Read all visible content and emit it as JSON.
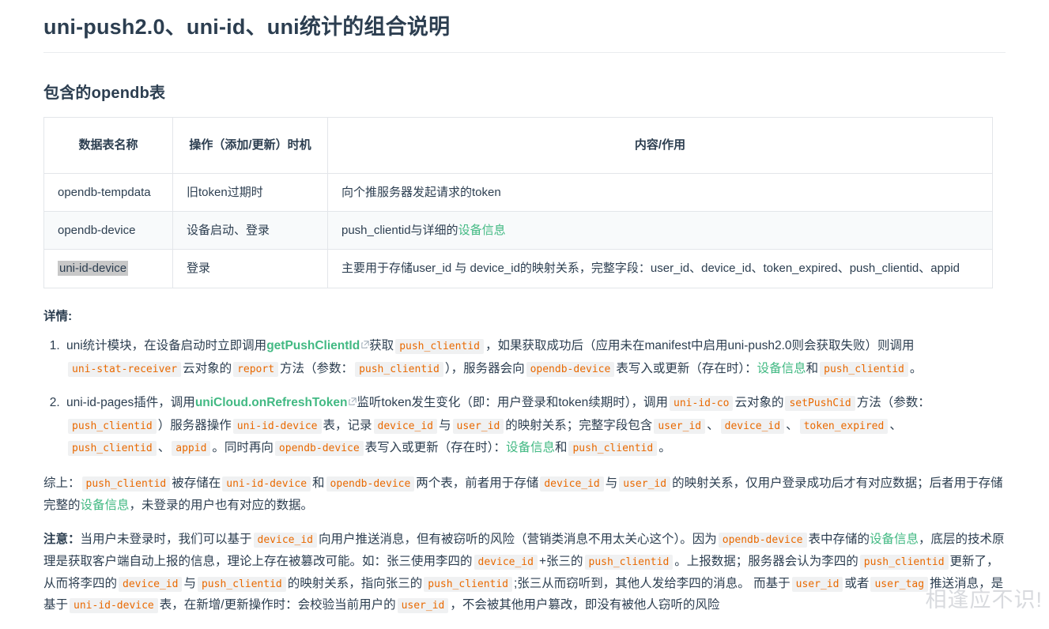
{
  "doc": {
    "title": "uni-push2.0、uni-id、uni统计的组合说明",
    "section_title": "包含的opendb表"
  },
  "colors": {
    "link_green": "#42b983",
    "code_orange": "#e96900",
    "code_bg": "#f0f1f2",
    "text": "#2c3e50",
    "border": "#e3e6ea",
    "row_stripe": "#f8fafb",
    "selection_gray": "#c8c8c8",
    "watermark": "#d8dade"
  },
  "table": {
    "headers": [
      "数据表名称",
      "操作（添加/更新）时机",
      "内容/作用"
    ],
    "rows": [
      {
        "name": "opendb-tempdata",
        "op": "旧token过期时",
        "content_pre": "向个推服务器发起请求的token",
        "link": "",
        "content_post": "",
        "striped": false,
        "selected": false
      },
      {
        "name": "opendb-device",
        "op": "设备启动、登录",
        "content_pre": "push_clientid与详细的",
        "link": "设备信息",
        "content_post": "",
        "striped": true,
        "selected": false
      },
      {
        "name": "uni-id-device",
        "op": "登录",
        "content_pre": "主要用于存储user_id 与 device_id的映射关系，完整字段：user_id、device_id、token_expired、push_clientid、appid",
        "link": "",
        "content_post": "",
        "striped": false,
        "selected": true
      }
    ]
  },
  "details": {
    "lead": "详情:",
    "item1": {
      "t1": "uni统计模块，在设备启动时立即调用",
      "link1": "getPushClientId",
      "t2": "获取",
      "c1": "push_clientid",
      "t3": "，如果获取成功后（应用未在manifest中启用uni-push2.0则会获取失败）则调用",
      "c2": "uni-stat-receiver",
      "t4": "云对象的",
      "c3": "report",
      "t5": "方法（参数：",
      "c4": "push_clientid",
      "t6": "），服务器会向",
      "c5": "opendb-device",
      "t7": "表写入或更新（存在时）：",
      "link2": "设备信息",
      "t8": "和",
      "c6": "push_clientid",
      "t9": "。"
    },
    "item2": {
      "t1": "uni-id-pages插件，调用",
      "link1": "uniCloud.onRefreshToken",
      "t2": "监听token发生变化（即：用户登录和token续期时），调用",
      "c1": "uni-id-co",
      "t3": "云对象的",
      "c2": "setPushCid",
      "t4": "方法（参数：",
      "c3": "push_clientid",
      "t5": "）服务器操作",
      "c4": "uni-id-device",
      "t6": "表，记录",
      "c5": "device_id",
      "t7": "与",
      "c6": "user_id",
      "t8": "的映射关系；完整字段包含",
      "c7": "user_id",
      "t9": "、",
      "c8": "device_id",
      "t10": "、",
      "c9": "token_expired",
      "t11": "、",
      "c10": "push_clientid",
      "t12": "、",
      "c11": "appid",
      "t13": "。同时再向",
      "c12": "opendb-device",
      "t14": "表写入或更新（存在时）：",
      "link2": "设备信息",
      "t15": "和",
      "c13": "push_clientid",
      "t16": "。"
    }
  },
  "summary": {
    "lead": "综上：",
    "c1": "push_clientid",
    "t1": "被存储在",
    "c2": "uni-id-device",
    "t2": "和",
    "c3": "opendb-device",
    "t3": "两个表，前者用于存储",
    "c4": "device_id",
    "t4": "与",
    "c5": "user_id",
    "t5": "的映射关系，仅用户登录成功后才有对应数据；后者用于存储完整的",
    "link1": "设备信息",
    "t6": "，未登录的用户也有对应的数据。"
  },
  "notice": {
    "lead": "注意：",
    "t1": "当用户未登录时，我们可以基于",
    "c1": "device_id",
    "t2": "向用户推送消息，但有被窃听的风险（营销类消息不用太关心这个）。因为",
    "c2": "opendb-device",
    "t3": "表中存储的",
    "link1": "设备信息",
    "t4": "，底层的技术原理是获取客户端自动上报的信息，理论上存在被篡改可能。如：张三使用李四的",
    "c3": "device_id",
    "t5": "+张三的",
    "c4": "push_clientid",
    "t6": "。上报数据；服务器会认为李四的",
    "c5": "push_clientid",
    "t7": "更新了，从而将李四的",
    "c6": "device_id",
    "t8": "与",
    "c7": "push_clientid",
    "t9": "的映射关系，指向张三的",
    "c8": "push_clientid",
    "t10": ";张三从而窃听到，其他人发给李四的消息。 而基于",
    "c9": "user_id",
    "t11": "或者",
    "c10": "user_tag",
    "t12": "推送消息，是基于",
    "c11": "uni-id-device",
    "t13": "表，在新增/更新操作时：会校验当前用户的",
    "c12": "user_id",
    "t14": "，不会被其他用户篡改，即没有被他人窃听的风险"
  },
  "watermark": {
    "text": "相逢应不识!"
  }
}
